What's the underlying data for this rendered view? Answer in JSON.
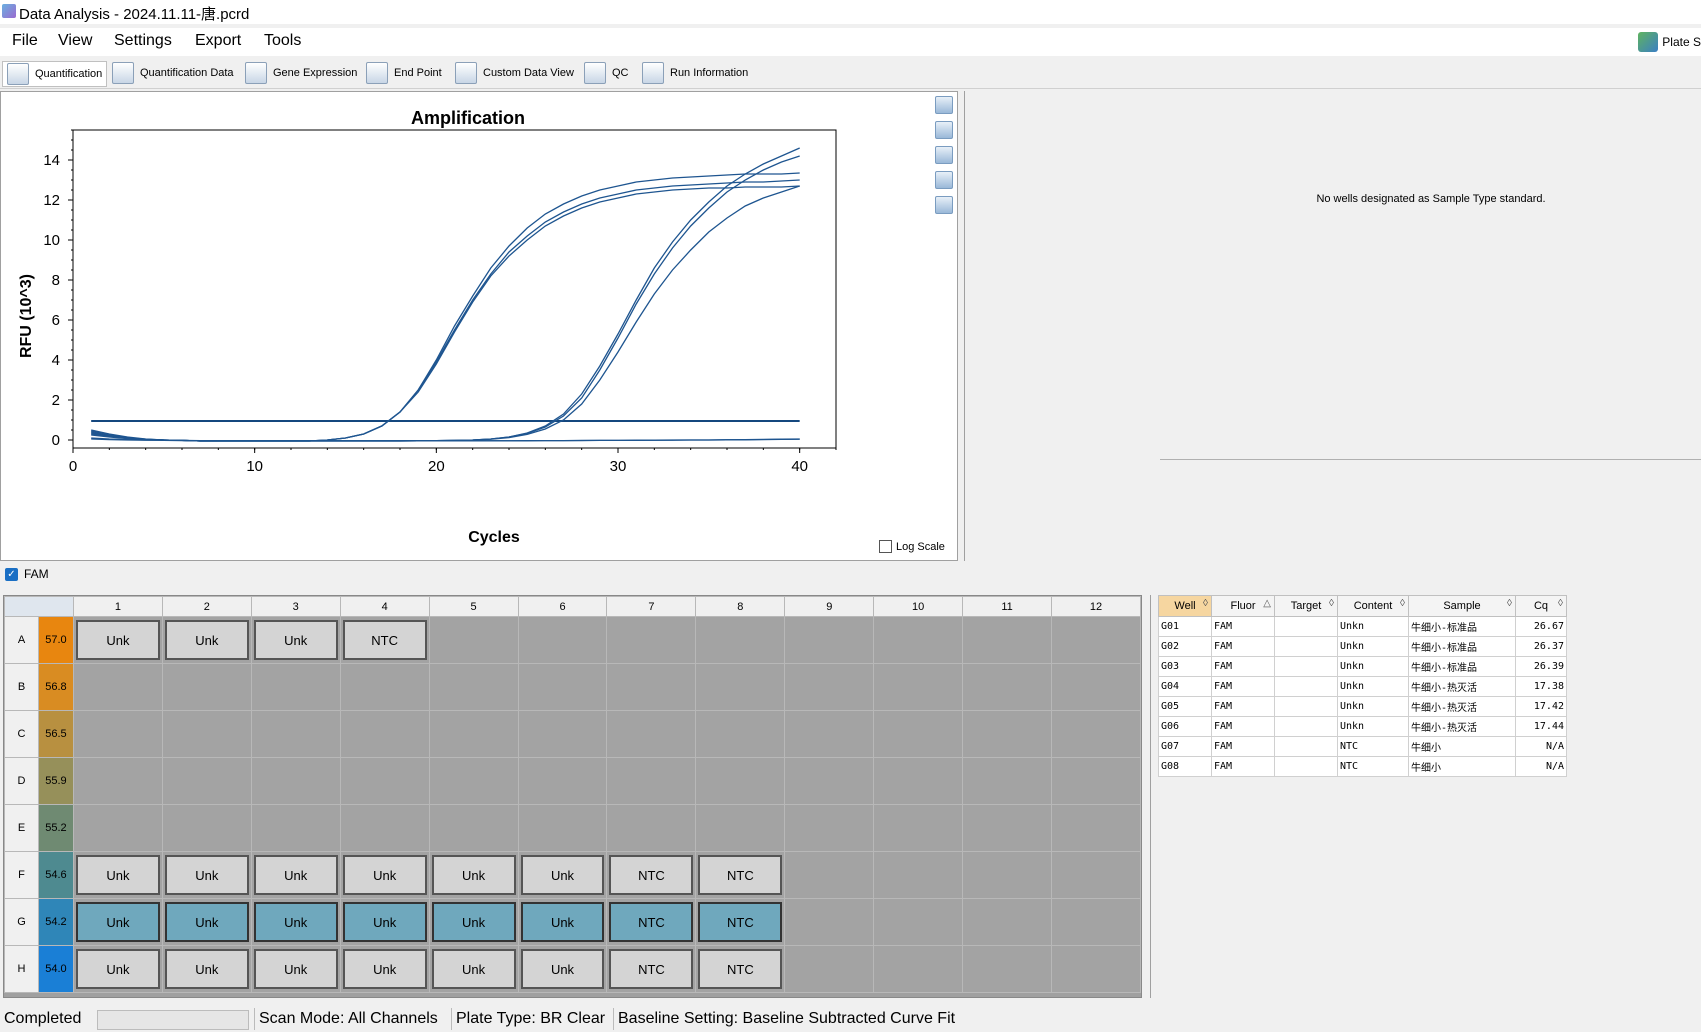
{
  "window": {
    "title": "Data Analysis - 2024.11.11-唐.pcrd"
  },
  "menu": {
    "items": [
      "File",
      "View",
      "Settings",
      "Export",
      "Tools"
    ],
    "plate_setup": "Plate S"
  },
  "toolbar": {
    "tabs": [
      "Quantification",
      "Quantification Data",
      "Gene Expression",
      "End Point",
      "Custom Data View",
      "QC",
      "Run Information"
    ],
    "active": "Quantification"
  },
  "chart_data": {
    "type": "line",
    "title": "Amplification",
    "xlabel": "Cycles",
    "ylabel": "RFU (10^3)",
    "xlim": [
      0,
      42
    ],
    "ylim": [
      -0.4,
      15.5
    ],
    "xticks": [
      0,
      10,
      20,
      30,
      40
    ],
    "yticks": [
      0,
      2,
      4,
      6,
      8,
      10,
      12,
      14
    ],
    "grid": true,
    "threshold": 0.95,
    "x": [
      1,
      2,
      3,
      4,
      5,
      6,
      7,
      8,
      9,
      10,
      11,
      12,
      13,
      14,
      15,
      16,
      17,
      18,
      19,
      20,
      21,
      22,
      23,
      24,
      25,
      26,
      27,
      28,
      29,
      30,
      31,
      32,
      33,
      34,
      35,
      36,
      37,
      38,
      39,
      40
    ],
    "series": [
      {
        "values": [
          0.5,
          0.3,
          0.15,
          0.05,
          0,
          -0.02,
          -0.05,
          -0.05,
          -0.05,
          -0.05,
          -0.05,
          -0.05,
          -0.05,
          0,
          0.1,
          0.3,
          0.7,
          1.4,
          2.5,
          3.9,
          5.5,
          7.0,
          8.3,
          9.4,
          10.2,
          10.9,
          11.4,
          11.8,
          12.1,
          12.3,
          12.5,
          12.6,
          12.7,
          12.75,
          12.8,
          12.85,
          12.9,
          12.9,
          12.95,
          13.0
        ]
      },
      {
        "values": [
          0.45,
          0.25,
          0.12,
          0.04,
          0,
          -0.02,
          -0.05,
          -0.05,
          -0.05,
          -0.05,
          -0.05,
          -0.05,
          -0.05,
          0,
          0.1,
          0.3,
          0.7,
          1.4,
          2.5,
          4.0,
          5.7,
          7.2,
          8.6,
          9.7,
          10.6,
          11.3,
          11.8,
          12.2,
          12.5,
          12.7,
          12.9,
          13.0,
          13.1,
          13.15,
          13.2,
          13.25,
          13.3,
          13.3,
          13.3,
          13.35
        ]
      },
      {
        "values": [
          0.4,
          0.2,
          0.1,
          0.03,
          0,
          -0.02,
          -0.05,
          -0.05,
          -0.05,
          -0.05,
          -0.05,
          -0.05,
          -0.05,
          0,
          0.1,
          0.3,
          0.7,
          1.4,
          2.4,
          3.8,
          5.4,
          6.9,
          8.2,
          9.2,
          10.0,
          10.7,
          11.2,
          11.6,
          11.9,
          12.1,
          12.3,
          12.4,
          12.5,
          12.55,
          12.6,
          12.6,
          12.65,
          12.65,
          12.65,
          12.7
        ]
      },
      {
        "values": [
          0.35,
          0.2,
          0.1,
          0.03,
          0,
          -0.02,
          -0.05,
          -0.05,
          -0.05,
          -0.05,
          -0.05,
          -0.05,
          -0.05,
          -0.05,
          -0.05,
          -0.05,
          -0.05,
          -0.05,
          -0.04,
          -0.03,
          -0.02,
          0,
          0.05,
          0.15,
          0.35,
          0.7,
          1.3,
          2.3,
          3.7,
          5.3,
          7.0,
          8.6,
          9.9,
          11.0,
          11.9,
          12.7,
          13.3,
          13.8,
          14.2,
          14.6
        ]
      },
      {
        "values": [
          0.3,
          0.18,
          0.08,
          0.02,
          0,
          -0.02,
          -0.05,
          -0.05,
          -0.05,
          -0.05,
          -0.05,
          -0.05,
          -0.05,
          -0.05,
          -0.05,
          -0.05,
          -0.05,
          -0.05,
          -0.04,
          -0.03,
          -0.02,
          0,
          0.05,
          0.15,
          0.33,
          0.65,
          1.2,
          2.1,
          3.5,
          5.1,
          6.8,
          8.3,
          9.6,
          10.7,
          11.6,
          12.4,
          13.0,
          13.5,
          13.9,
          14.2
        ]
      },
      {
        "values": [
          0.25,
          0.15,
          0.07,
          0.02,
          0,
          -0.02,
          -0.05,
          -0.05,
          -0.05,
          -0.05,
          -0.05,
          -0.05,
          -0.05,
          -0.05,
          -0.05,
          -0.05,
          -0.05,
          -0.05,
          -0.04,
          -0.03,
          -0.02,
          0,
          0.04,
          0.12,
          0.28,
          0.55,
          1.0,
          1.8,
          3.0,
          4.4,
          5.9,
          7.3,
          8.5,
          9.5,
          10.4,
          11.1,
          11.7,
          12.1,
          12.4,
          12.7
        ]
      },
      {
        "values": [
          0.1,
          0.05,
          0.02,
          0,
          0,
          -0.02,
          -0.03,
          -0.04,
          -0.04,
          -0.04,
          -0.04,
          -0.04,
          -0.04,
          -0.04,
          -0.04,
          -0.04,
          -0.04,
          -0.04,
          -0.04,
          -0.04,
          -0.04,
          -0.04,
          -0.04,
          -0.04,
          -0.03,
          -0.03,
          -0.03,
          -0.02,
          -0.02,
          -0.02,
          -0.01,
          -0.01,
          0,
          0,
          0,
          0.01,
          0.02,
          0.03,
          0.04,
          0.05
        ]
      },
      {
        "values": [
          0.05,
          0.02,
          0,
          -0.01,
          -0.02,
          -0.03,
          -0.03,
          -0.04,
          -0.04,
          -0.04,
          -0.04,
          -0.04,
          -0.04,
          -0.04,
          -0.04,
          -0.04,
          -0.04,
          -0.04,
          -0.04,
          -0.04,
          -0.04,
          -0.04,
          -0.04,
          -0.04,
          -0.04,
          -0.03,
          -0.03,
          -0.03,
          -0.02,
          -0.02,
          -0.02,
          -0.01,
          -0.01,
          0,
          0,
          0.01,
          0.01,
          0.02,
          0.03,
          0.04
        ]
      }
    ]
  },
  "side_icons": [
    "copy-icon",
    "chart-settings-icon",
    "export-icon",
    "zoom-icon",
    "curve-icon"
  ],
  "log_scale_label": "Log Scale",
  "standard_message": "No wells designated as Sample Type standard.",
  "fam_label": "FAM",
  "plate": {
    "columns": [
      "1",
      "2",
      "3",
      "4",
      "5",
      "6",
      "7",
      "8",
      "9",
      "10",
      "11",
      "12"
    ],
    "rows": [
      {
        "label": "A",
        "temp": "57.0",
        "color": "#e8860f",
        "wells": [
          "Unk",
          "Unk",
          "Unk",
          "NTC",
          "",
          "",
          "",
          "",
          "",
          "",
          "",
          ""
        ],
        "selected": false
      },
      {
        "label": "B",
        "temp": "56.8",
        "color": "#d98c22",
        "wells": [
          "",
          "",
          "",
          "",
          "",
          "",
          "",
          "",
          "",
          "",
          "",
          ""
        ],
        "selected": false
      },
      {
        "label": "C",
        "temp": "56.5",
        "color": "#b89040",
        "wells": [
          "",
          "",
          "",
          "",
          "",
          "",
          "",
          "",
          "",
          "",
          "",
          ""
        ],
        "selected": false
      },
      {
        "label": "D",
        "temp": "55.9",
        "color": "#96905a",
        "wells": [
          "",
          "",
          "",
          "",
          "",
          "",
          "",
          "",
          "",
          "",
          "",
          ""
        ],
        "selected": false
      },
      {
        "label": "E",
        "temp": "55.2",
        "color": "#6f8a72",
        "wells": [
          "",
          "",
          "",
          "",
          "",
          "",
          "",
          "",
          "",
          "",
          "",
          ""
        ],
        "selected": false
      },
      {
        "label": "F",
        "temp": "54.6",
        "color": "#4e8a90",
        "wells": [
          "Unk",
          "Unk",
          "Unk",
          "Unk",
          "Unk",
          "Unk",
          "NTC",
          "NTC",
          "",
          "",
          "",
          ""
        ],
        "selected": false
      },
      {
        "label": "G",
        "temp": "54.2",
        "color": "#2f86b8",
        "wells": [
          "Unk",
          "Unk",
          "Unk",
          "Unk",
          "Unk",
          "Unk",
          "NTC",
          "NTC",
          "",
          "",
          "",
          ""
        ],
        "selected": true
      },
      {
        "label": "H",
        "temp": "54.0",
        "color": "#1a7fd6",
        "wells": [
          "Unk",
          "Unk",
          "Unk",
          "Unk",
          "Unk",
          "Unk",
          "NTC",
          "NTC",
          "",
          "",
          "",
          ""
        ],
        "selected": false
      }
    ]
  },
  "results": {
    "headers": [
      "Well",
      "Fluor",
      "Target",
      "Content",
      "Sample",
      "Cq"
    ],
    "rows": [
      [
        "G01",
        "FAM",
        "",
        "Unkn",
        "牛细小-标准品",
        "26.67"
      ],
      [
        "G02",
        "FAM",
        "",
        "Unkn",
        "牛细小-标准品",
        "26.37"
      ],
      [
        "G03",
        "FAM",
        "",
        "Unkn",
        "牛细小-标准品",
        "26.39"
      ],
      [
        "G04",
        "FAM",
        "",
        "Unkn",
        "牛细小-热灭活",
        "17.38"
      ],
      [
        "G05",
        "FAM",
        "",
        "Unkn",
        "牛细小-热灭活",
        "17.42"
      ],
      [
        "G06",
        "FAM",
        "",
        "Unkn",
        "牛细小-热灭活",
        "17.44"
      ],
      [
        "G07",
        "FAM",
        "",
        "NTC",
        "牛细小",
        "N/A"
      ],
      [
        "G08",
        "FAM",
        "",
        "NTC",
        "牛细小",
        "N/A"
      ]
    ]
  },
  "status": {
    "state": "Completed",
    "scan_mode": "Scan Mode: All Channels",
    "plate_type": "Plate Type: BR Clear",
    "baseline": "Baseline Setting: Baseline Subtracted Curve Fit"
  }
}
